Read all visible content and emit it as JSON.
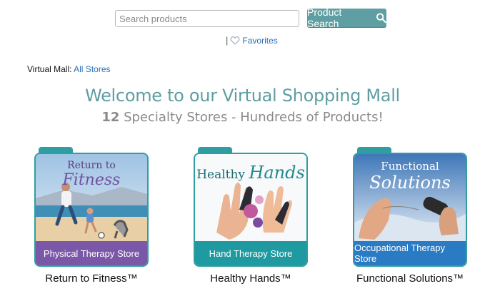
{
  "search": {
    "placeholder": "Search products",
    "button_label": "Product Search"
  },
  "favorites": {
    "separator": "|",
    "label": "Favorites"
  },
  "breadcrumb": {
    "prefix": "Virtual Mall:",
    "link": "All Stores"
  },
  "header": {
    "title": "Welcome to our Virtual Shopping Mall",
    "subtitle_count": "12",
    "subtitle_rest": " Specialty Stores - Hundreds of Products!"
  },
  "stores": [
    {
      "art_line1": "Return to",
      "art_line2": "Fitness",
      "band": "Physical Therapy Store",
      "caption": "Return to Fitness™",
      "band_color": "#7b57a7"
    },
    {
      "art_line1": "Healthy",
      "art_line2": "Hands",
      "band": "Hand Therapy Store",
      "caption": "Healthy Hands™",
      "band_color": "#1f9aa0"
    },
    {
      "art_line1": "Functional",
      "art_line2": "Solutions",
      "band": "Occupational Therapy Store",
      "caption": "Functional Solutions™",
      "band_color": "#2a7bc4"
    }
  ],
  "colors": {
    "accent": "#5f9ea2",
    "link": "#2a72b8"
  },
  "icons": {
    "search": "search-icon",
    "favorites": "heart-icon"
  }
}
